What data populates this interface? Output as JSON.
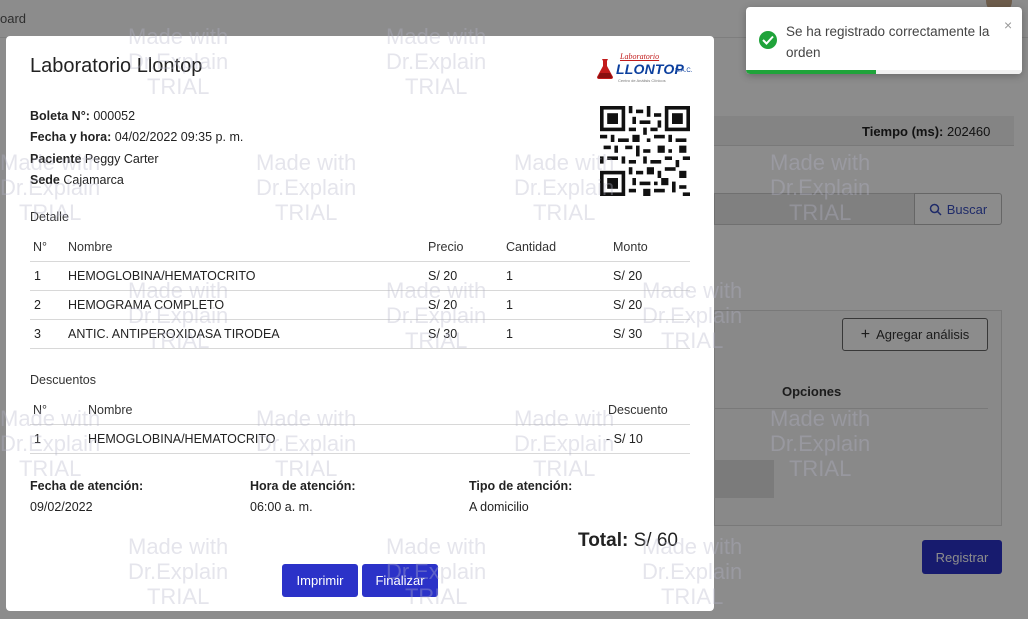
{
  "background": {
    "breadcrumb": "oard",
    "tiempo_label": "Tiempo (ms):",
    "tiempo_value": "202460",
    "buscar_label": "Buscar",
    "agregar_label": "Agregar análisis",
    "opciones_header": "Opciones",
    "registrar_label": "Registrar"
  },
  "modal": {
    "title": "Laboratorio Llontop",
    "logo": {
      "small_text": "Laboratorio",
      "brand": "LLONTOP",
      "suffix": "S.A.C.",
      "tagline": "Centro de Análisis Clínicos"
    },
    "boleta_label": "Boleta N°:",
    "boleta_value": "000052",
    "fecha_label": "Fecha y hora:",
    "fecha_value": "04/02/2022 09:35 p. m.",
    "paciente_label": "Paciente",
    "paciente_value": "Peggy Carter",
    "sede_label": "Sede",
    "sede_value": "Cajamarca",
    "detalle_label": "Detalle",
    "detalle_headers": {
      "n": "N°",
      "nombre": "Nombre",
      "precio": "Precio",
      "cantidad": "Cantidad",
      "monto": "Monto"
    },
    "detalle_rows": [
      {
        "n": "1",
        "nombre": "HEMOGLOBINA/HEMATOCRITO",
        "precio": "S/ 20",
        "cantidad": "1",
        "monto": "S/ 20"
      },
      {
        "n": "2",
        "nombre": "HEMOGRAMA COMPLETO",
        "precio": "S/ 20",
        "cantidad": "1",
        "monto": "S/ 20"
      },
      {
        "n": "3",
        "nombre": "ANTIC. ANTIPEROXIDASA TIRODEA",
        "precio": "S/ 30",
        "cantidad": "1",
        "monto": "S/ 30"
      }
    ],
    "descuentos_label": "Descuentos",
    "descuentos_headers": {
      "n": "N°",
      "nombre": "Nombre",
      "descuento": "Descuento"
    },
    "descuentos_rows": [
      {
        "n": "1",
        "nombre": "HEMOGLOBINA/HEMATOCRITO",
        "descuento": "- S/ 10"
      }
    ],
    "fecha_atencion_label": "Fecha de atención:",
    "fecha_atencion_value": "09/02/2022",
    "hora_atencion_label": "Hora de atención:",
    "hora_atencion_value": "06:00 a. m.",
    "tipo_atencion_label": "Tipo de atención:",
    "tipo_atencion_value": "A domicilio",
    "total_label": "Total:",
    "total_value": "S/ 60",
    "imprimir_label": "Imprimir",
    "finalizar_label": "Finalizar"
  },
  "toast": {
    "message": "Se ha registrado correctamente la orden",
    "close_symbol": "×",
    "progress": 0.47
  },
  "watermark": "Made with\nDr.Explain\nTRIAL",
  "colors": {
    "primary": "#2b32c8",
    "success": "#1fa33a",
    "logo_blue": "#0b3f9e",
    "logo_red": "#c21b1b"
  }
}
